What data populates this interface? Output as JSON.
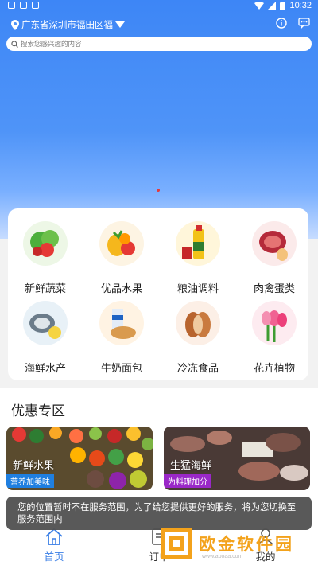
{
  "status_bar": {
    "time": "10:32"
  },
  "header": {
    "location": "广东省深圳市福田区福",
    "search_placeholder": "搜索您感兴趣的内容"
  },
  "categories": [
    {
      "label": "新鲜蔬菜"
    },
    {
      "label": "优品水果"
    },
    {
      "label": "粮油调料"
    },
    {
      "label": "肉禽蛋类"
    },
    {
      "label": "海鲜水产"
    },
    {
      "label": "牛奶面包"
    },
    {
      "label": "冷冻食品"
    },
    {
      "label": "花卉植物"
    }
  ],
  "promo": {
    "title": "优惠专区",
    "cards": [
      {
        "name": "新鲜水果",
        "tag": "营养加美味",
        "tag_color": "#1f7fe0"
      },
      {
        "name": "生猛海鲜",
        "tag": "为料理加分",
        "tag_color": "#9a28c8"
      }
    ]
  },
  "toast": {
    "message": "您的位置暂时不在服务范围，为了给您提供更好的服务，将为您切换至服务范围内"
  },
  "nav": {
    "items": [
      {
        "label": "首页"
      },
      {
        "label": "订单"
      },
      {
        "label": "我的"
      }
    ]
  },
  "watermark": {
    "text": "欧金软件园",
    "sub": "www.apoaa.com"
  },
  "colors": {
    "accent": "#3b7fe6",
    "banner": "#4f94f8"
  }
}
